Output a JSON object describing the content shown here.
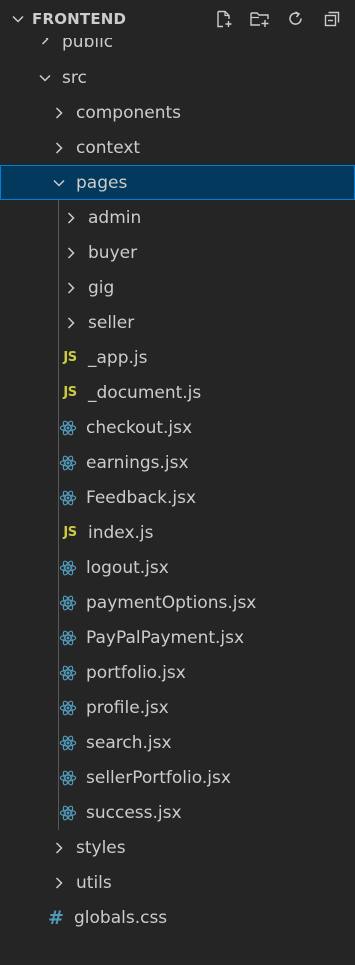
{
  "header": {
    "title": "FRONTEND",
    "actions": [
      "new-file-icon",
      "new-folder-icon",
      "refresh-icon",
      "collapse-all-icon"
    ]
  },
  "tree": {
    "public": "public",
    "src": "src",
    "components": "components",
    "context": "context",
    "pages": "pages",
    "admin": "admin",
    "buyer": "buyer",
    "gig": "gig",
    "seller": "seller",
    "app_js": "_app.js",
    "document_js": "_document.js",
    "checkout": "checkout.jsx",
    "earnings": "earnings.jsx",
    "feedback": "Feedback.jsx",
    "index_js": "index.js",
    "logout": "logout.jsx",
    "paymentOptions": "paymentOptions.jsx",
    "paypalPayment": "PayPalPayment.jsx",
    "portfolio": "portfolio.jsx",
    "profile": "profile.jsx",
    "search": "search.jsx",
    "sellerPortfolio": "sellerPortfolio.jsx",
    "success": "success.jsx",
    "styles": "styles",
    "utils": "utils",
    "globals_css": "globals.css"
  },
  "icons": {
    "js_label": "JS",
    "css_label": "#"
  },
  "colors": {
    "background": "#252526",
    "selected": "#04395e",
    "selected_border": "#007fd4",
    "js_icon": "#cbcb41",
    "react_icon": "#519aba",
    "css_icon": "#519aba",
    "text": "#cccccc"
  }
}
